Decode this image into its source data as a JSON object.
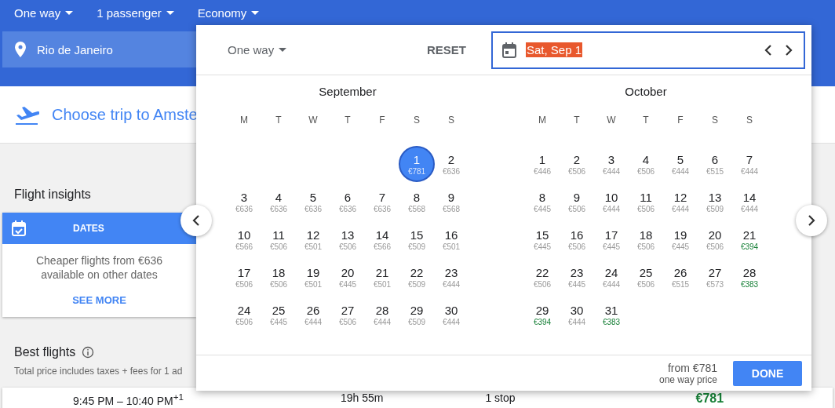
{
  "top_bar": {
    "dropdowns": [
      "One way",
      "1 passenger",
      "Economy"
    ]
  },
  "origin": {
    "value": "Rio de Janeiro"
  },
  "trip_header": {
    "title": "Choose trip to Amste"
  },
  "insights": {
    "title": "Flight insights",
    "tab": "DATES",
    "text": "Cheaper flights from €636 available on other dates",
    "link": "SEE MORE"
  },
  "best_flights": {
    "title": "Best flights",
    "subtitle": "Total price includes taxes + fees for 1 ad"
  },
  "flight_row": {
    "times": "9:45 PM – 10:40 PM",
    "day_offset": "+1",
    "duration": "19h 55m",
    "stops": "1 stop",
    "price": "€781"
  },
  "date_picker": {
    "trip_type": "One way",
    "reset": "RESET",
    "date_field": {
      "value": "Sat, Sep 1",
      "text_selected": true
    },
    "months": [
      {
        "name": "September",
        "weekdays": [
          "M",
          "T",
          "W",
          "T",
          "F",
          "S",
          "S"
        ],
        "days": [
          {
            "kind": "blank"
          },
          {
            "kind": "blank"
          },
          {
            "kind": "blank"
          },
          {
            "kind": "blank"
          },
          {
            "kind": "blank"
          },
          {
            "kind": "day",
            "day": "1",
            "price": "€781",
            "selected": true,
            "cheap": false
          },
          {
            "kind": "day",
            "day": "2",
            "price": "€636",
            "selected": false,
            "cheap": false
          },
          {
            "kind": "day",
            "day": "3",
            "price": "€636",
            "selected": false,
            "cheap": false
          },
          {
            "kind": "day",
            "day": "4",
            "price": "€636",
            "selected": false,
            "cheap": false
          },
          {
            "kind": "day",
            "day": "5",
            "price": "€636",
            "selected": false,
            "cheap": false
          },
          {
            "kind": "day",
            "day": "6",
            "price": "€636",
            "selected": false,
            "cheap": false
          },
          {
            "kind": "day",
            "day": "7",
            "price": "€636",
            "selected": false,
            "cheap": false
          },
          {
            "kind": "day",
            "day": "8",
            "price": "€568",
            "selected": false,
            "cheap": false
          },
          {
            "kind": "day",
            "day": "9",
            "price": "€568",
            "selected": false,
            "cheap": false
          },
          {
            "kind": "day",
            "day": "10",
            "price": "€566",
            "selected": false,
            "cheap": false
          },
          {
            "kind": "day",
            "day": "11",
            "price": "€506",
            "selected": false,
            "cheap": false
          },
          {
            "kind": "day",
            "day": "12",
            "price": "€501",
            "selected": false,
            "cheap": false
          },
          {
            "kind": "day",
            "day": "13",
            "price": "€506",
            "selected": false,
            "cheap": false
          },
          {
            "kind": "day",
            "day": "14",
            "price": "€566",
            "selected": false,
            "cheap": false
          },
          {
            "kind": "day",
            "day": "15",
            "price": "€509",
            "selected": false,
            "cheap": false
          },
          {
            "kind": "day",
            "day": "16",
            "price": "€501",
            "selected": false,
            "cheap": false
          },
          {
            "kind": "day",
            "day": "17",
            "price": "€506",
            "selected": false,
            "cheap": false
          },
          {
            "kind": "day",
            "day": "18",
            "price": "€506",
            "selected": false,
            "cheap": false
          },
          {
            "kind": "day",
            "day": "19",
            "price": "€501",
            "selected": false,
            "cheap": false
          },
          {
            "kind": "day",
            "day": "20",
            "price": "€445",
            "selected": false,
            "cheap": false
          },
          {
            "kind": "day",
            "day": "21",
            "price": "€501",
            "selected": false,
            "cheap": false
          },
          {
            "kind": "day",
            "day": "22",
            "price": "€509",
            "selected": false,
            "cheap": false
          },
          {
            "kind": "day",
            "day": "23",
            "price": "€444",
            "selected": false,
            "cheap": false
          },
          {
            "kind": "day",
            "day": "24",
            "price": "€506",
            "selected": false,
            "cheap": false
          },
          {
            "kind": "day",
            "day": "25",
            "price": "€445",
            "selected": false,
            "cheap": false
          },
          {
            "kind": "day",
            "day": "26",
            "price": "€444",
            "selected": false,
            "cheap": false
          },
          {
            "kind": "day",
            "day": "27",
            "price": "€506",
            "selected": false,
            "cheap": false
          },
          {
            "kind": "day",
            "day": "28",
            "price": "€444",
            "selected": false,
            "cheap": false
          },
          {
            "kind": "day",
            "day": "29",
            "price": "€509",
            "selected": false,
            "cheap": false
          },
          {
            "kind": "day",
            "day": "30",
            "price": "€444",
            "selected": false,
            "cheap": false
          }
        ]
      },
      {
        "name": "October",
        "weekdays": [
          "M",
          "T",
          "W",
          "T",
          "F",
          "S",
          "S"
        ],
        "days": [
          {
            "kind": "day",
            "day": "1",
            "price": "€446",
            "selected": false,
            "cheap": false
          },
          {
            "kind": "day",
            "day": "2",
            "price": "€506",
            "selected": false,
            "cheap": false
          },
          {
            "kind": "day",
            "day": "3",
            "price": "€444",
            "selected": false,
            "cheap": false
          },
          {
            "kind": "day",
            "day": "4",
            "price": "€506",
            "selected": false,
            "cheap": false
          },
          {
            "kind": "day",
            "day": "5",
            "price": "€444",
            "selected": false,
            "cheap": false
          },
          {
            "kind": "day",
            "day": "6",
            "price": "€515",
            "selected": false,
            "cheap": false
          },
          {
            "kind": "day",
            "day": "7",
            "price": "€444",
            "selected": false,
            "cheap": false
          },
          {
            "kind": "day",
            "day": "8",
            "price": "€445",
            "selected": false,
            "cheap": false
          },
          {
            "kind": "day",
            "day": "9",
            "price": "€506",
            "selected": false,
            "cheap": false
          },
          {
            "kind": "day",
            "day": "10",
            "price": "€444",
            "selected": false,
            "cheap": false
          },
          {
            "kind": "day",
            "day": "11",
            "price": "€506",
            "selected": false,
            "cheap": false
          },
          {
            "kind": "day",
            "day": "12",
            "price": "€444",
            "selected": false,
            "cheap": false
          },
          {
            "kind": "day",
            "day": "13",
            "price": "€509",
            "selected": false,
            "cheap": false
          },
          {
            "kind": "day",
            "day": "14",
            "price": "€444",
            "selected": false,
            "cheap": false
          },
          {
            "kind": "day",
            "day": "15",
            "price": "€445",
            "selected": false,
            "cheap": false
          },
          {
            "kind": "day",
            "day": "16",
            "price": "€506",
            "selected": false,
            "cheap": false
          },
          {
            "kind": "day",
            "day": "17",
            "price": "€445",
            "selected": false,
            "cheap": false
          },
          {
            "kind": "day",
            "day": "18",
            "price": "€506",
            "selected": false,
            "cheap": false
          },
          {
            "kind": "day",
            "day": "19",
            "price": "€445",
            "selected": false,
            "cheap": false
          },
          {
            "kind": "day",
            "day": "20",
            "price": "€506",
            "selected": false,
            "cheap": false
          },
          {
            "kind": "day",
            "day": "21",
            "price": "€394",
            "selected": false,
            "cheap": true
          },
          {
            "kind": "day",
            "day": "22",
            "price": "€506",
            "selected": false,
            "cheap": false
          },
          {
            "kind": "day",
            "day": "23",
            "price": "€445",
            "selected": false,
            "cheap": false
          },
          {
            "kind": "day",
            "day": "24",
            "price": "€444",
            "selected": false,
            "cheap": false
          },
          {
            "kind": "day",
            "day": "25",
            "price": "€506",
            "selected": false,
            "cheap": false
          },
          {
            "kind": "day",
            "day": "26",
            "price": "€515",
            "selected": false,
            "cheap": false
          },
          {
            "kind": "day",
            "day": "27",
            "price": "€573",
            "selected": false,
            "cheap": false
          },
          {
            "kind": "day",
            "day": "28",
            "price": "€383",
            "selected": false,
            "cheap": true
          },
          {
            "kind": "day",
            "day": "29",
            "price": "€394",
            "selected": false,
            "cheap": true
          },
          {
            "kind": "day",
            "day": "30",
            "price": "€444",
            "selected": false,
            "cheap": false
          },
          {
            "kind": "day",
            "day": "31",
            "price": "€383",
            "selected": false,
            "cheap": true
          }
        ]
      }
    ],
    "footer": {
      "price": "from €781",
      "note": "one way price",
      "done": "DONE"
    }
  }
}
